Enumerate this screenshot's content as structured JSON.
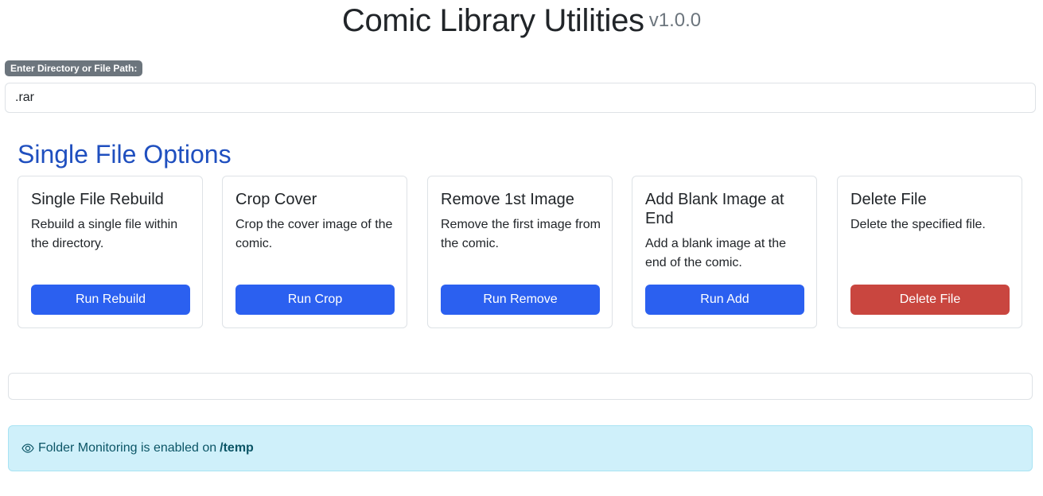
{
  "header": {
    "title": "Comic Library Utilities",
    "version": "v1.0.0"
  },
  "path_field": {
    "label": "Enter Directory or File Path:",
    "value": ".rar",
    "placeholder": ""
  },
  "section_title": "Single File Options",
  "cards": [
    {
      "title": "Single File Rebuild",
      "text": "Rebuild a single file within the directory.",
      "button": "Run Rebuild"
    },
    {
      "title": "Crop Cover",
      "text": "Crop the cover image of the comic.",
      "button": "Run Crop"
    },
    {
      "title": "Remove 1st Image",
      "text": "Remove the first image from the comic.",
      "button": "Run Remove"
    },
    {
      "title": "Add Blank Image at End",
      "text": "Add a blank image at the end of the comic.",
      "button": "Run Add"
    },
    {
      "title": "Delete File",
      "text": "Delete the specified file.",
      "button": "Delete File"
    }
  ],
  "output": "",
  "alert": {
    "icon": "eye-icon",
    "text": "Folder Monitoring is enabled on",
    "folder": "/temp"
  },
  "colors": {
    "primary": "#2b60f0",
    "danger": "#c9463f",
    "section_title": "#1f4fbf",
    "alert_bg": "#cff0fa"
  }
}
